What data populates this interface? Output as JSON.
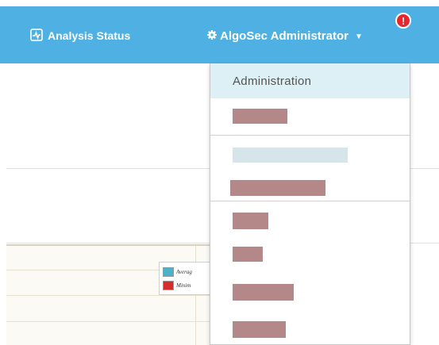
{
  "topbar": {
    "background": "#4fb1e3",
    "analysis_label": "Analysis Status",
    "analysis_icon": "pulse-chart-icon",
    "admin_label": "AlgoSec Administrator",
    "admin_icon": "gear-icon",
    "caret_icon": "caret-down-icon",
    "alert_badge": "!"
  },
  "chart": {
    "legend": [
      {
        "label": "Averag",
        "color": "#4cb2c8"
      },
      {
        "label": "Minim",
        "color": "#d62c2c"
      }
    ]
  },
  "dropdown": {
    "header": "Administration",
    "redacted_color": "#b48888",
    "redacted_light_color": "#d6e5ea"
  }
}
